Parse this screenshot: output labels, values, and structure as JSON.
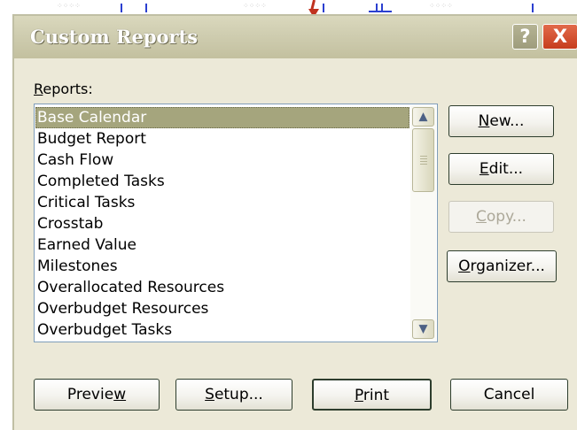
{
  "window": {
    "title": "Custom Reports",
    "help_label": "?",
    "close_label": "X"
  },
  "reports": {
    "label_prefix": "R",
    "label_rest": "eports:",
    "items": [
      "Base Calendar",
      "Budget Report",
      "Cash Flow",
      "Completed Tasks",
      "Critical Tasks",
      "Crosstab",
      "Earned Value",
      "Milestones",
      "Overallocated Resources",
      "Overbudget Resources",
      "Overbudget Tasks"
    ],
    "selected_index": 0
  },
  "scrollbar": {
    "up_glyph": "▲",
    "down_glyph": "▼"
  },
  "side_buttons": {
    "new": {
      "mnemonic": "N",
      "rest": "ew...",
      "enabled": true
    },
    "edit": {
      "mnemonic": "E",
      "rest": "dit...",
      "enabled": true
    },
    "copy": {
      "mnemonic": "C",
      "rest": "opy...",
      "enabled": false
    },
    "organizer": {
      "mnemonic": "O",
      "rest": "rganizer...",
      "enabled": true
    }
  },
  "bottom_buttons": {
    "preview": {
      "pre": "Previe",
      "mnemonic": "w",
      "post": ""
    },
    "setup": {
      "pre": "",
      "mnemonic": "S",
      "post": "etup..."
    },
    "print": {
      "pre": "",
      "mnemonic": "P",
      "post": "rint"
    },
    "cancel": {
      "label": "Cancel"
    }
  },
  "colors": {
    "dialog_bg": "#ece9d8",
    "selection_bg": "#a5a57d",
    "close_red": "#c63d1d",
    "disabled_text": "#aca899"
  }
}
